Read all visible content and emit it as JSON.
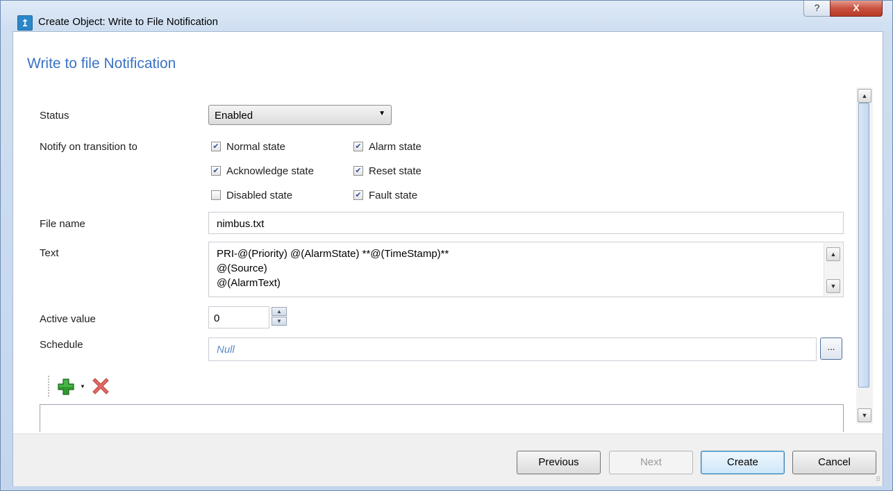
{
  "window": {
    "title": "Create Object: Write to File Notification",
    "help_label": "?",
    "close_label": "X"
  },
  "form": {
    "heading": "Write to file Notification",
    "status": {
      "label": "Status",
      "value": "Enabled"
    },
    "notify": {
      "label": "Notify on transition to",
      "options": [
        {
          "label": "Normal state",
          "checked": true
        },
        {
          "label": "Alarm state",
          "checked": true
        },
        {
          "label": "Acknowledge state",
          "checked": true
        },
        {
          "label": "Reset state",
          "checked": true
        },
        {
          "label": "Disabled state",
          "checked": false
        },
        {
          "label": "Fault state",
          "checked": true
        }
      ]
    },
    "file_name": {
      "label": "File name",
      "value": "nimbus.txt"
    },
    "text": {
      "label": "Text",
      "lines": [
        "PRI-@(Priority) @(AlarmState) **@(TimeStamp)**",
        "@(Source)",
        "@(AlarmText)"
      ]
    },
    "active_value": {
      "label": "Active value",
      "value": "0"
    },
    "schedule": {
      "label": "Schedule",
      "placeholder": "Null",
      "browse_label": "..."
    }
  },
  "toolbar": {
    "add_icon": "add-icon",
    "delete_icon": "delete-icon"
  },
  "footer": {
    "previous": "Previous",
    "next": "Next",
    "create": "Create",
    "cancel": "Cancel"
  },
  "colors": {
    "heading": "#3b72c4",
    "placeholder": "#5b8ac7",
    "add_green": "#2f9b2f",
    "delete_red": "#e06a63"
  }
}
